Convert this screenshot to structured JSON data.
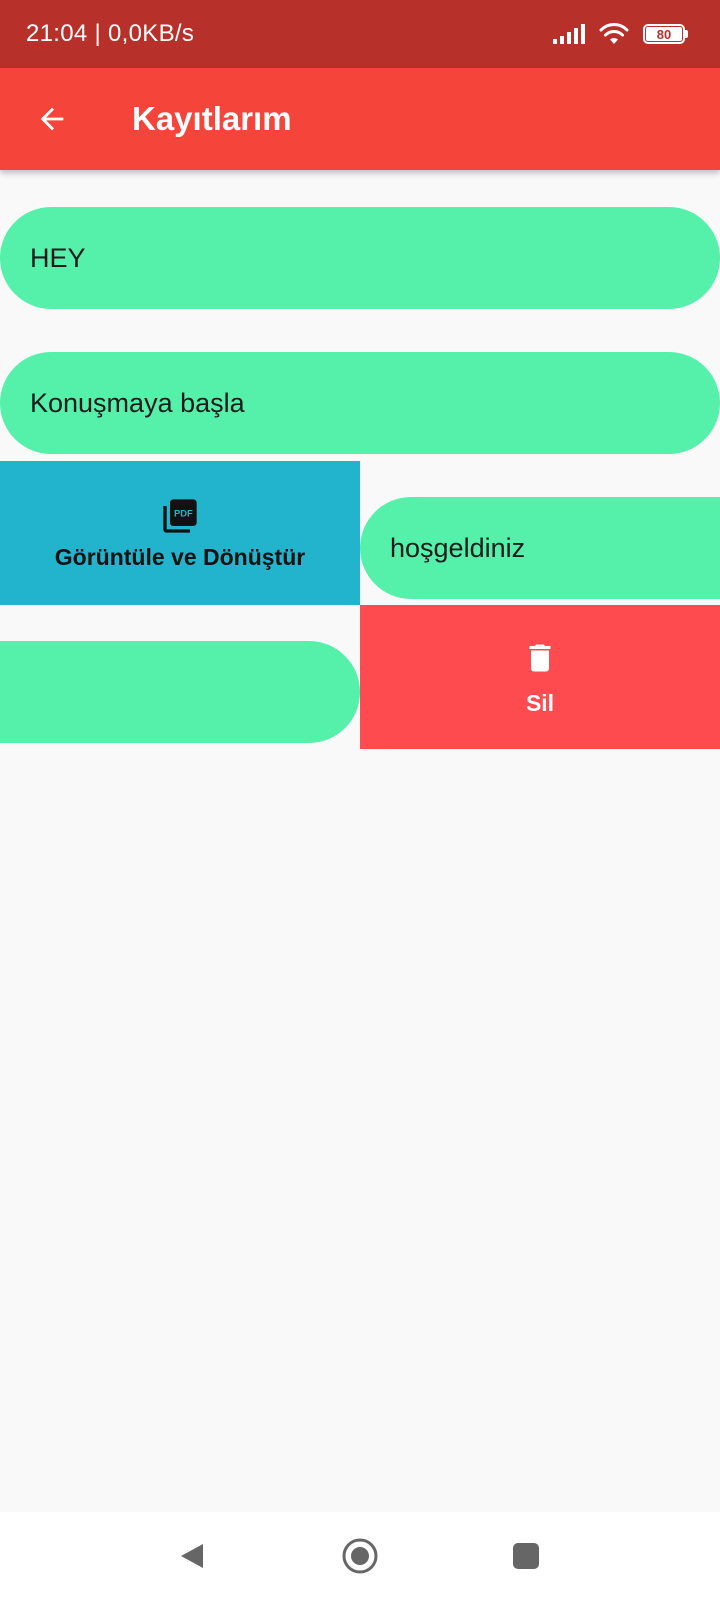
{
  "status_bar": {
    "time_and_speed": "21:04 | 0,0KB/s",
    "battery_level": "80"
  },
  "app_bar": {
    "title": "Kayıtlarım"
  },
  "records": [
    {
      "text": "HEY"
    },
    {
      "text": "Konuşmaya başla"
    },
    {
      "text": "hoşgeldiniz"
    },
    {
      "text": ""
    }
  ],
  "actions": {
    "pdf_label": "Görüntüle ve Dönüştür",
    "delete_label": "Sil"
  },
  "colors": {
    "status_bar": "#b7312a",
    "app_bar": "#f5443a",
    "record": "#55f0aa",
    "pdf_action": "#22b4cc",
    "delete_action": "#fe4b4f",
    "background": "#f9f9f9"
  },
  "icons": {
    "back": "arrow-back-icon",
    "pdf": "picture-as-pdf-icon",
    "delete": "trash-icon",
    "nav_back": "nav-back-icon",
    "nav_home": "nav-home-icon",
    "nav_recents": "nav-recents-icon"
  }
}
